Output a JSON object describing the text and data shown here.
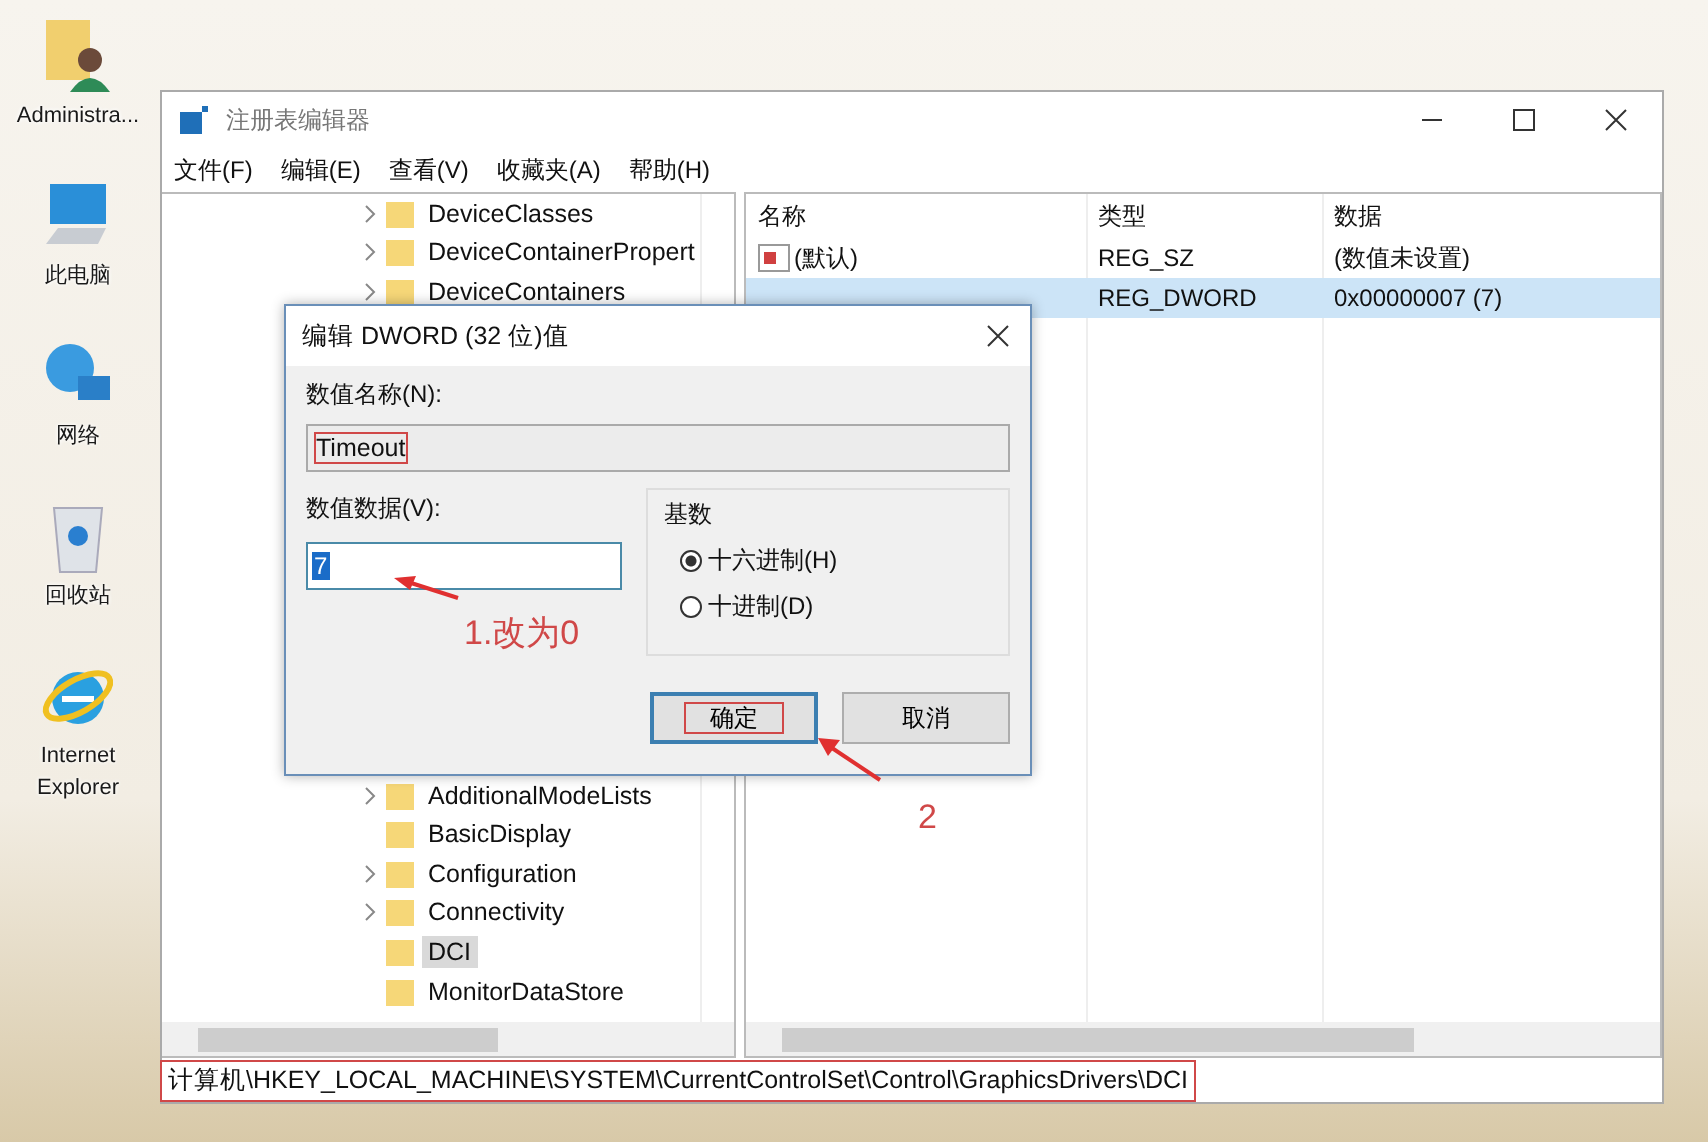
{
  "desktop_icons": [
    {
      "kind": "user",
      "label": "Administra..."
    },
    {
      "kind": "computer",
      "label": "此电脑"
    },
    {
      "kind": "network",
      "label": "网络"
    },
    {
      "kind": "recycle",
      "label": "回收站"
    },
    {
      "kind": "ie",
      "label": "Internet Explorer"
    }
  ],
  "window": {
    "title": "注册表编辑器"
  },
  "menu": [
    "文件(F)",
    "编辑(E)",
    "查看(V)",
    "收藏夹(A)",
    "帮助(H)"
  ],
  "tree": {
    "items_above": [
      {
        "label": "DeviceClasses",
        "expandable": true,
        "selected": false
      },
      {
        "label": "DeviceContainerPropert",
        "expandable": true,
        "selected": false
      },
      {
        "label": "DeviceContainers",
        "expandable": true,
        "selected": false
      }
    ],
    "items_below": [
      {
        "label": "AdditionalModeLists",
        "expandable": true,
        "selected": false
      },
      {
        "label": "BasicDisplay",
        "expandable": false,
        "selected": false
      },
      {
        "label": "Configuration",
        "expandable": true,
        "selected": false
      },
      {
        "label": "Connectivity",
        "expandable": true,
        "selected": false
      },
      {
        "label": "DCI",
        "expandable": false,
        "selected": true
      },
      {
        "label": "MonitorDataStore",
        "expandable": false,
        "selected": false
      }
    ]
  },
  "values": {
    "columns": [
      "名称",
      "类型",
      "数据"
    ],
    "rows": [
      {
        "name": "(默认)",
        "type": "REG_SZ",
        "data": "(数值未设置)",
        "selected": false
      },
      {
        "type": "REG_DWORD",
        "data": "0x00000007 (7)",
        "selected": true
      }
    ]
  },
  "status_bar": {
    "path": "计算机\\HKEY_LOCAL_MACHINE\\SYSTEM\\CurrentControlSet\\Control\\GraphicsDrivers\\DCI",
    "highlighted": true
  },
  "dialog": {
    "title": "编辑 DWORD (32 位)值",
    "name_label": "数值名称(N):",
    "name_value": "Timeout",
    "name_highlighted": true,
    "data_label": "数值数据(V):",
    "data_value": "7",
    "data_value_selected": true,
    "base_label": "基数",
    "radios": [
      {
        "label": "十六进制(H)",
        "selected": true
      },
      {
        "label": "十进制(D)",
        "selected": false
      }
    ],
    "buttons": [
      {
        "label": "确定",
        "default": true,
        "highlighted": true
      },
      {
        "label": "取消",
        "default": false,
        "highlighted": false
      }
    ]
  },
  "annotations": [
    {
      "text": "1.改为0"
    },
    {
      "text": "2"
    }
  ]
}
